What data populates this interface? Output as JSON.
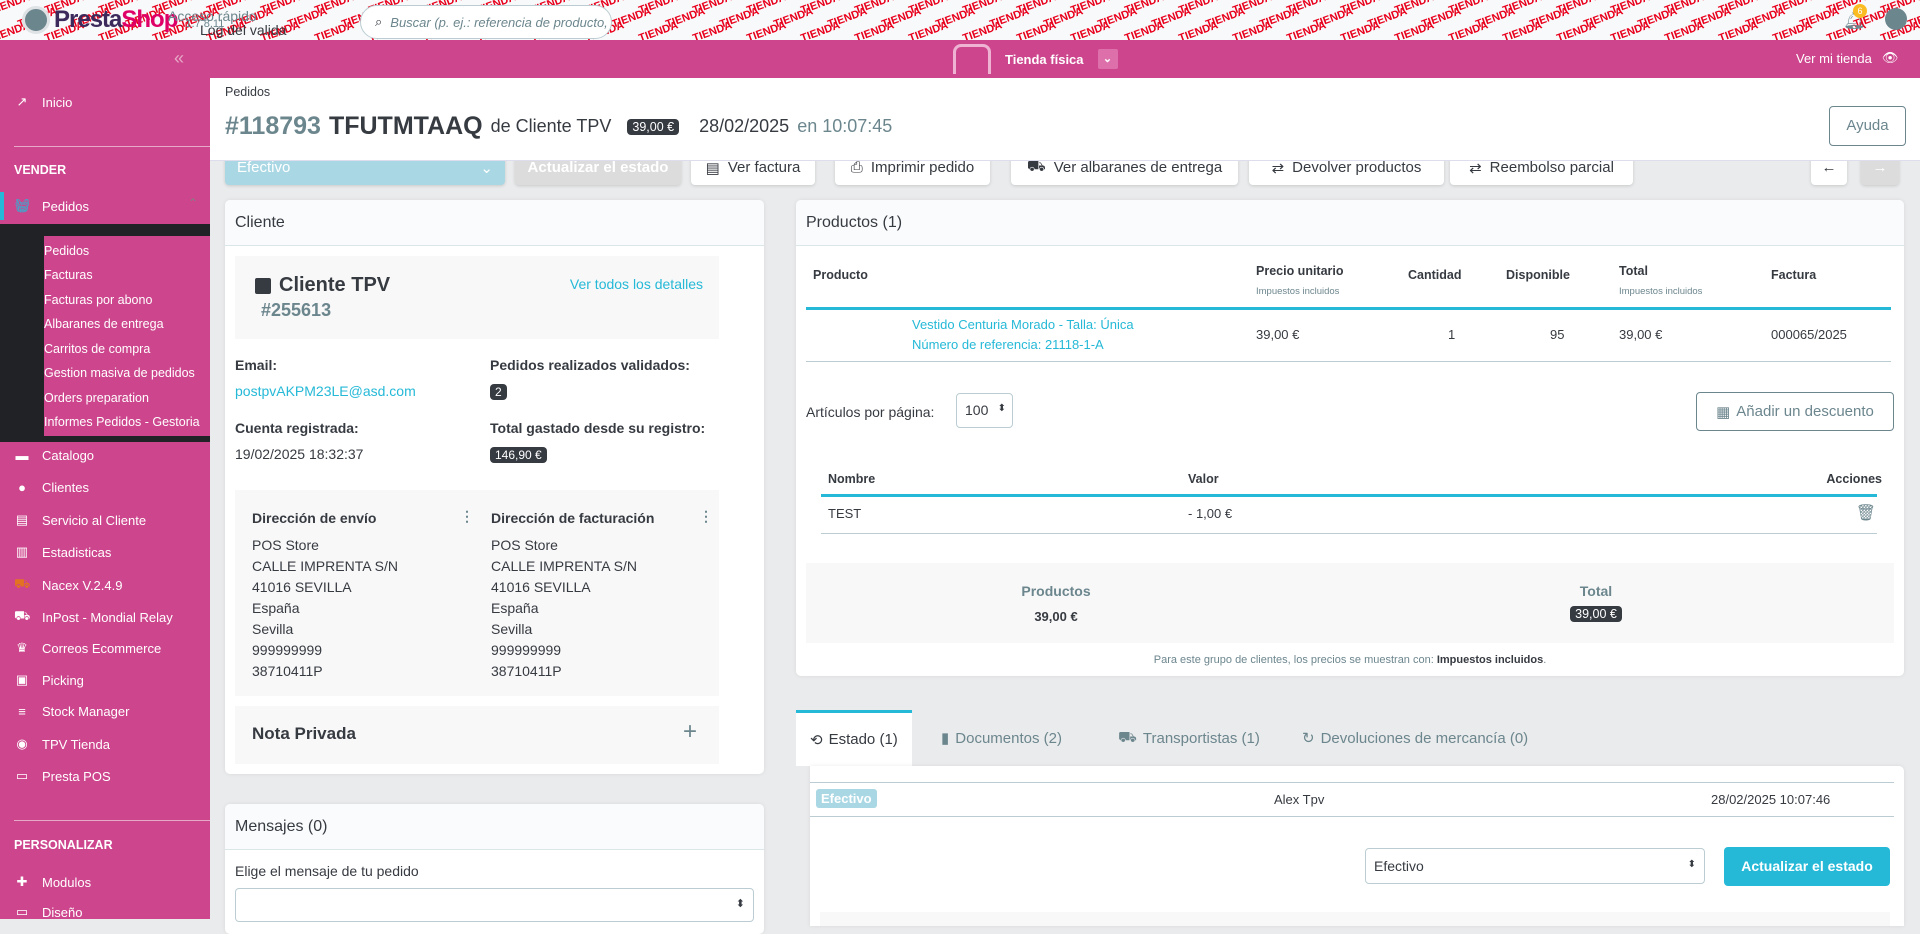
{
  "topbar": {
    "watermark": "TIENDA",
    "logo": "PrestaShop",
    "version": "1.7.8.11",
    "quick_access": "Acceso rápido",
    "quick_access_item": "Log del valida",
    "search_placeholder": "Buscar (p. ej.: referencia de producto,",
    "notifications": "6"
  },
  "pinkbar": {
    "store": "Tienda física",
    "view_shop": "Ver mi tienda"
  },
  "sidebar": {
    "inicio": "Inicio",
    "vender": "VENDER",
    "pedidos": "Pedidos",
    "sub": [
      "Pedidos",
      "Facturas",
      "Facturas por abono",
      "Albaranes de entrega",
      "Carritos de compra",
      "Gestion masiva de pedidos",
      "Orders preparation",
      "Informes Pedidos - Gestoria"
    ],
    "items": [
      {
        "label": "Catalogo",
        "icon": "▬"
      },
      {
        "label": "Clientes",
        "icon": "●"
      },
      {
        "label": "Servicio al Cliente",
        "icon": "▤"
      },
      {
        "label": "Estadisticas",
        "icon": "▥"
      },
      {
        "label": "Nacex V.2.4.9",
        "icon": "⛟"
      },
      {
        "label": "InPost - Mondial Relay",
        "icon": "⛟"
      },
      {
        "label": "Correos Ecommerce",
        "icon": "♛"
      },
      {
        "label": "Picking",
        "icon": "▣"
      },
      {
        "label": "Stock Manager",
        "icon": "≡"
      },
      {
        "label": "TPV Tienda",
        "icon": "◉"
      },
      {
        "label": "Presta POS",
        "icon": "▭"
      }
    ],
    "personalizar": "PERSONALIZAR",
    "modulos": "Modulos",
    "diseno": "Diseño"
  },
  "header": {
    "breadcrumb": "Pedidos",
    "order_num": "#118793",
    "reference": "TFUTMTAAQ",
    "de": "de Cliente TPV",
    "total": "39,00 €",
    "date": "28/02/2025",
    "en": "en 10:07:45",
    "help": "Ayuda"
  },
  "toolbar": {
    "status": "Efectivo",
    "update": "Actualizar el estado",
    "invoice": "Ver factura",
    "print": "Imprimir pedido",
    "delivery": "Ver albaranes de entrega",
    "return": "Devolver productos",
    "refund": "Reembolso parcial"
  },
  "customer": {
    "title": "Cliente",
    "name": "Cliente TPV",
    "id": "#255613",
    "details": "Ver todos los detalles",
    "email_label": "Email:",
    "email": "postpvAKPM23LE@asd.com",
    "orders_label": "Pedidos realizados validados:",
    "orders": "2",
    "registered_label": "Cuenta registrada:",
    "registered": "19/02/2025 18:32:37",
    "spent_label": "Total gastado desde su registro:",
    "spent": "146,90 €",
    "shipping_title": "Dirección de envío",
    "billing_title": "Dirección de facturación",
    "address": [
      "POS Store",
      "CALLE IMPRENTA S/N",
      "41016 SEVILLA",
      "España",
      "Sevilla",
      "999999999",
      "38710411P"
    ],
    "note": "Nota Privada"
  },
  "messages": {
    "title": "Mensajes (0)",
    "label": "Elige el mensaje de tu pedido"
  },
  "products": {
    "title": "Productos (1)",
    "cols": {
      "product": "Producto",
      "price": "Precio unitario",
      "price_sub": "Impuestos incluidos",
      "qty": "Cantidad",
      "avail": "Disponible",
      "total": "Total",
      "total_sub": "Impuestos incluidos",
      "invoice": "Factura"
    },
    "row": {
      "name": "Vestido Centuria Morado - Talla: Única",
      "ref": "Número de referencia: 21118-1-A",
      "price": "39,00 €",
      "qty": "1",
      "avail": "95",
      "total": "39,00 €",
      "invoice": "000065/2025"
    },
    "per_page_label": "Artículos por página:",
    "per_page": "100",
    "add_discount": "Añadir un descuento",
    "disc_cols": {
      "name": "Nombre",
      "value": "Valor",
      "actions": "Acciones"
    },
    "disc_row": {
      "name": "TEST",
      "value": "- 1,00 €"
    },
    "sum_products_label": "Productos",
    "sum_products": "39,00 €",
    "sum_total_label": "Total",
    "sum_total": "39,00 €",
    "tax_note": "Para este grupo de clientes, los precios se muestran con:",
    "tax_note_bold": "Impuestos incluidos"
  },
  "tabs": [
    {
      "label": "Estado (1)",
      "icon": "⟲"
    },
    {
      "label": "Documentos (2)",
      "icon": "▮"
    },
    {
      "label": "Transportistas (1)",
      "icon": "⛟"
    },
    {
      "label": "Devoluciones de mercancía (0)",
      "icon": "↻"
    }
  ],
  "history": {
    "status": "Efectivo",
    "employee": "Alex Tpv",
    "date": "28/02/2025 10:07:46",
    "select": "Efectivo",
    "update": "Actualizar el estado"
  }
}
